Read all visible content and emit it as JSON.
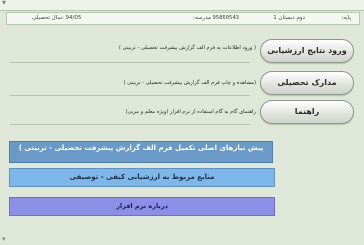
{
  "info": {
    "date": "94/05 :سال تحصیلی",
    "school_label": "مدرسه:",
    "school": "95860543",
    "year_label": "دوم دبستان 1",
    "year": "پایه:"
  },
  "buttons": {
    "enter_results": "ورود نتایج ارزشیابی",
    "docs": "مدارک تحصیلی",
    "guide": "راهنما"
  },
  "descriptions": {
    "enter_results": "( ورود اطلاعات به فرم الف گزارش پیشرفت تحصیلی - تربیتی )",
    "docs": "(مشاهده و چاپ فرم الف گزارش پیشرفت تحصیلی - تربیتی )",
    "guide": "راهنمای گام به گام استفاده از نرم افزار (ویژه معلم و مربی)"
  },
  "wide_buttons": {
    "prereq": "پیش نیازهای اصلی تکمیل فرم الف گزارش پیشرفت تحصیلی - تربیتی )",
    "resources": "منابع مربوط به ارزشیابی کیفی - توصیفی",
    "about": "درباره نرم افزار"
  },
  "colors": {
    "background": "#dfe8d8",
    "prereq": "#6a9bc8",
    "resources": "#7db6e8",
    "about": "#8c8fe8"
  }
}
